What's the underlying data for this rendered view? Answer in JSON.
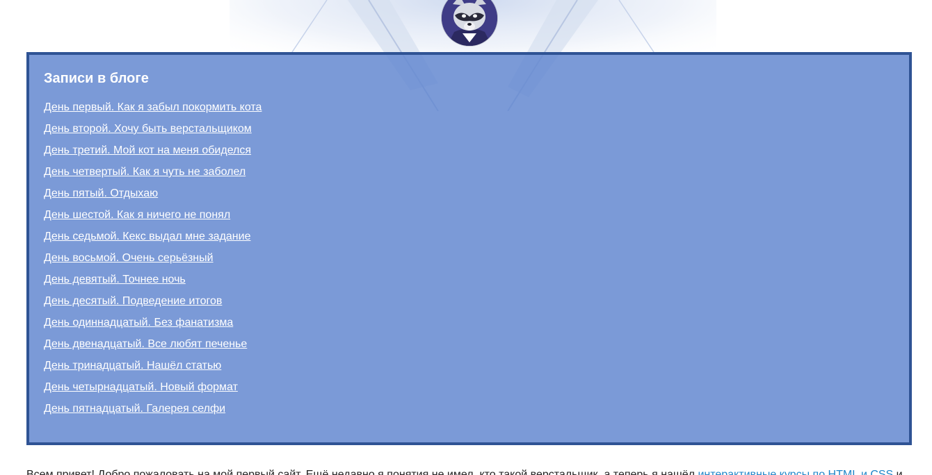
{
  "header": {
    "avatar_icon": "raccoon-avatar-icon"
  },
  "blog": {
    "title": "Записи в блоге",
    "posts": [
      "День первый. Как я забыл покормить кота",
      "День второй. Хочу быть верстальщиком",
      "День третий. Мой кот на меня обиделся",
      "День четвертый. Как я чуть не заболел",
      "День пятый. Отдыхаю",
      "День шестой. Как я ничего не понял",
      "День седьмой. Кекс выдал мне задание",
      "День восьмой. Очень серьёзный",
      "День девятый. Точнее ночь",
      "День десятый. Подведение итогов",
      "День одиннадцатый. Без фанатизма",
      "День двенадцатый. Все любят печенье",
      "День тринадцатый. Нашёл статью",
      "День четырнадцатый. Новый формат",
      "День пятнадцатый. Галерея селфи"
    ]
  },
  "intro": {
    "text_before": "Всем привет! Добро пожаловать на мой первый сайт. Ещё недавно я понятия не имел, кто такой верстальщик, а теперь я нашёл ",
    "link": "интерактивные курсы по HTML и CSS",
    "text_after": " и"
  },
  "colors": {
    "panel_background": "#7b99d6",
    "panel_border": "#2f5394",
    "link_color": "#1f86c9"
  }
}
